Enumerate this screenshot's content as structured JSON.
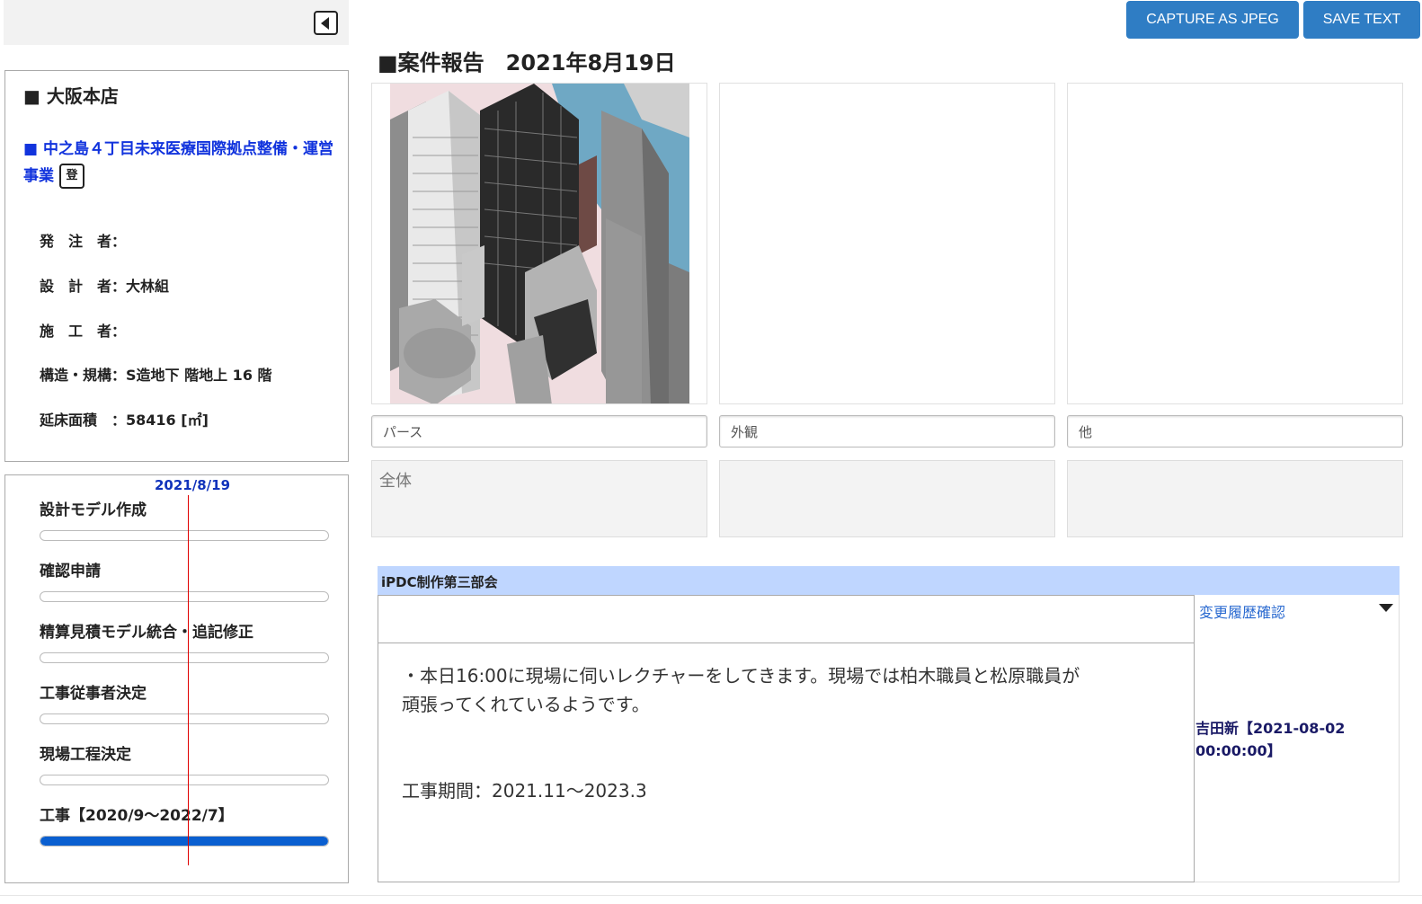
{
  "toolbar": {
    "capture_label": "CAPTURE AS JPEG",
    "save_label": "SAVE TEXT"
  },
  "report": {
    "title": "■案件報告　2021年8月19日"
  },
  "info": {
    "branch": "■ 大阪本店",
    "project": "■ 中之島４丁目未来医療国際拠点整備・運営事業",
    "reg_badge": "登",
    "fields": [
      {
        "label": "発　注　者：",
        "value": ""
      },
      {
        "label": "設　計　者：",
        "value": "大林組"
      },
      {
        "label": "施　工　者：",
        "value": ""
      },
      {
        "label": "構造・規構：",
        "value": "S造地下 階地上 16 階"
      },
      {
        "label": "延床面積　：",
        "value": "58416 [㎡]"
      }
    ]
  },
  "schedule": {
    "today_label": "2021/8/19",
    "tasks": [
      {
        "name": "設計モデル作成",
        "progress": 0
      },
      {
        "name": "確認申請",
        "progress": 0
      },
      {
        "name": "精算見積モデル統合・追記修正",
        "progress": 0
      },
      {
        "name": "工事従事者決定",
        "progress": 0
      },
      {
        "name": "現場工程決定",
        "progress": 0
      },
      {
        "name": "工事【2020/9〜2022/7】",
        "progress": 1.0
      }
    ]
  },
  "images": [
    {
      "caption": "パース",
      "description": "全体",
      "has_image": true
    },
    {
      "caption": "外観",
      "description": "",
      "has_image": false
    },
    {
      "caption": "他",
      "description": "",
      "has_image": false
    }
  ],
  "department": {
    "name": "iPDC制作第三部会",
    "comment": "・本日16:00に現場に伺いレクチャーをしてきます。現場では柏木職員と松原職員が\n頑張ってくれているようです。\n\n\n工事期間：2021.11〜2023.3",
    "history_link": "変更履歴確認",
    "history_entry": "吉田新【2021-08-02 00:00:00】"
  },
  "colors": {
    "accent": "#2f7dc4",
    "project_link": "#1133dd",
    "today_line": "#e00000",
    "progress_fill": "#0a5fd0",
    "dept_header": "#bfd6ff"
  }
}
